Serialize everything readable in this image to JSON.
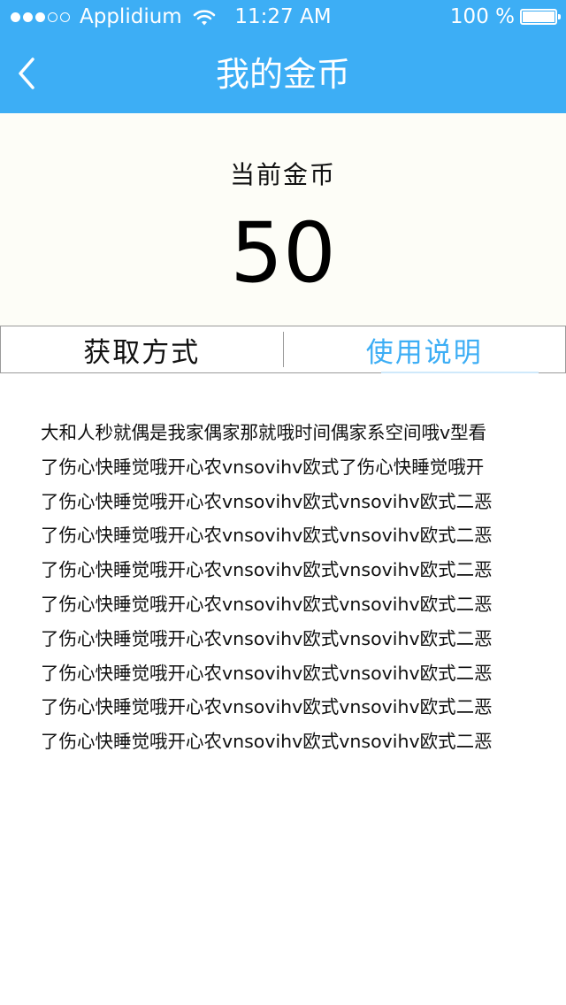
{
  "status_bar": {
    "carrier": "Applidium",
    "time": "11:27 AM",
    "battery": "100 %",
    "signal_dots_filled": 3,
    "signal_dots_total": 5
  },
  "nav": {
    "title": "我的金币",
    "back_icon": "chevron-left-icon"
  },
  "coins": {
    "label": "当前金币",
    "value": "50"
  },
  "tabs": [
    {
      "label": "获取方式",
      "active": false
    },
    {
      "label": "使用说明",
      "active": true
    }
  ],
  "content": {
    "lines": [
      "大和人秒就偶是我家偶家那就哦时间偶家系空间哦v型看",
      "了伤心快睡觉哦开心农vnsovihv欧式了伤心快睡觉哦开",
      "了伤心快睡觉哦开心农vnsovihv欧式vnsovihv欧式二恶",
      "了伤心快睡觉哦开心农vnsovihv欧式vnsovihv欧式二恶",
      "了伤心快睡觉哦开心农vnsovihv欧式vnsovihv欧式二恶",
      "了伤心快睡觉哦开心农vnsovihv欧式vnsovihv欧式二恶",
      "了伤心快睡觉哦开心农vnsovihv欧式vnsovihv欧式二恶",
      "了伤心快睡觉哦开心农vnsovihv欧式vnsovihv欧式二恶",
      "了伤心快睡觉哦开心农vnsovihv欧式vnsovihv欧式二恶",
      "了伤心快睡觉哦开心农vnsovihv欧式vnsovihv欧式二恶"
    ]
  },
  "colors": {
    "accent": "#3daef5",
    "panel_background": "#fdfdf7"
  }
}
